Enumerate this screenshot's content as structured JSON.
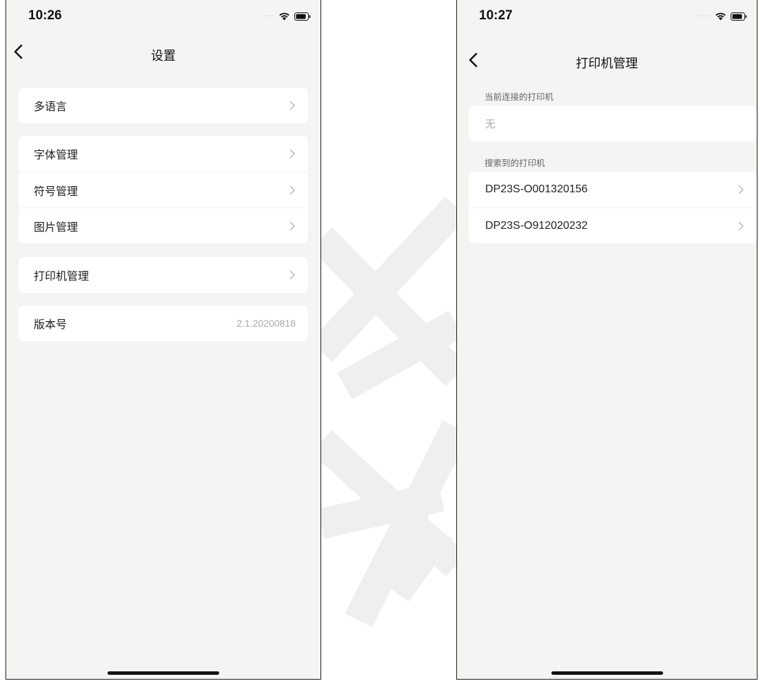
{
  "screens": {
    "settings": {
      "status_time": "10:26",
      "title": "设置",
      "groups": [
        [
          {
            "label": "多语言"
          }
        ],
        [
          {
            "label": "字体管理"
          },
          {
            "label": "符号管理"
          },
          {
            "label": "图片管理"
          }
        ],
        [
          {
            "label": "打印机管理"
          }
        ],
        [
          {
            "label": "版本号",
            "value": "2.1.20200818"
          }
        ]
      ]
    },
    "printer_management": {
      "status_time": "10:27",
      "title": "打印机管理",
      "connected_header": "当前连接的打印机",
      "connected_value": "无",
      "found_header": "搜索到的打印机",
      "printers": [
        {
          "name": "DP23S-O001320156"
        },
        {
          "name": "DP23S-O912020232"
        }
      ]
    }
  },
  "icons": {
    "back": "chevron-left-icon",
    "disclosure": "chevron-right-icon",
    "wifi": "wifi-icon",
    "battery": "battery-icon",
    "signal": "signal-dots-icon"
  },
  "colors": {
    "screen_background": "#f4f4f2",
    "card_background": "#ffffff",
    "primary_text": "#1e1e1e",
    "secondary_text": "#a8a8a8"
  }
}
